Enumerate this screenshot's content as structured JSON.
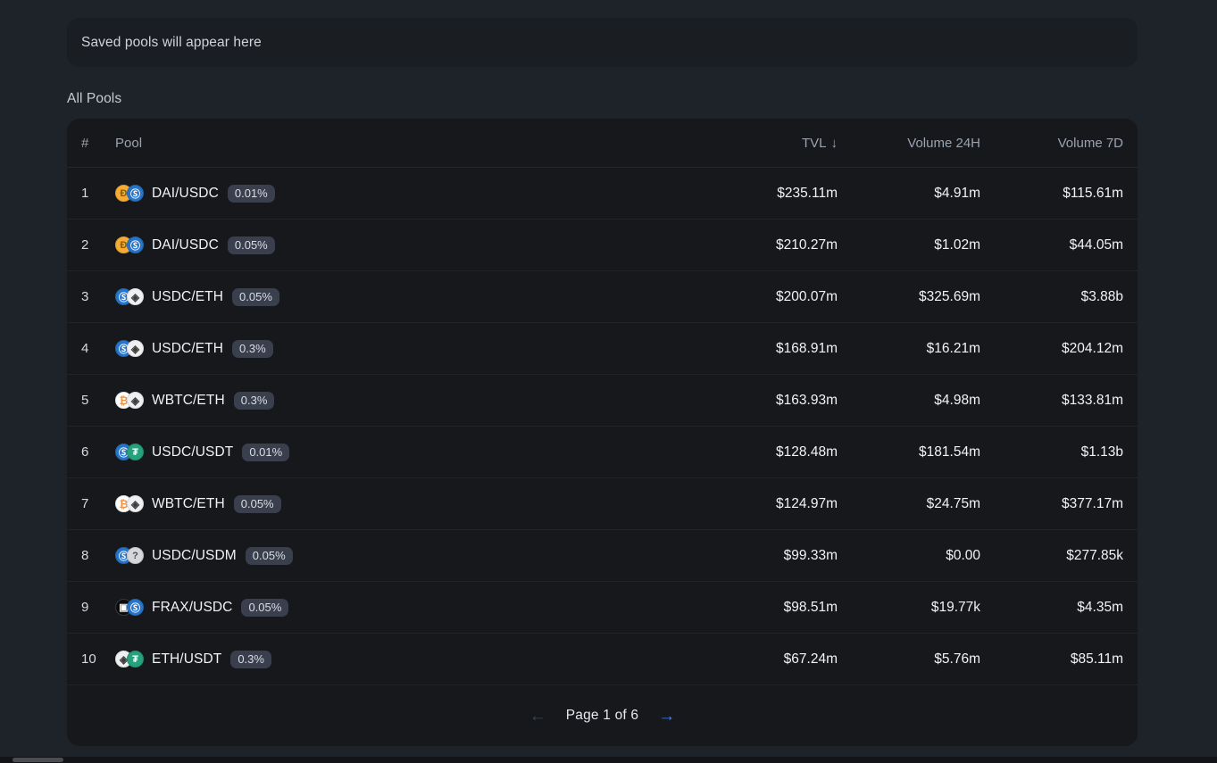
{
  "saved": {
    "empty_text": "Saved pools will appear here"
  },
  "section": {
    "title": "All Pools"
  },
  "table": {
    "headers": {
      "rank": "#",
      "pool": "Pool",
      "tvl": "TVL",
      "tvl_sort_icon": "↓",
      "volume_24h": "Volume 24H",
      "volume_7d": "Volume 7D"
    },
    "rows": [
      {
        "rank": "1",
        "pool": "DAI/USDC",
        "fee": "0.01%",
        "token0": "DAI",
        "token1": "USDC",
        "tvl": "$235.11m",
        "volume_24h": "$4.91m",
        "volume_7d": "$115.61m"
      },
      {
        "rank": "2",
        "pool": "DAI/USDC",
        "fee": "0.05%",
        "token0": "DAI",
        "token1": "USDC",
        "tvl": "$210.27m",
        "volume_24h": "$1.02m",
        "volume_7d": "$44.05m"
      },
      {
        "rank": "3",
        "pool": "USDC/ETH",
        "fee": "0.05%",
        "token0": "USDC",
        "token1": "ETH",
        "tvl": "$200.07m",
        "volume_24h": "$325.69m",
        "volume_7d": "$3.88b"
      },
      {
        "rank": "4",
        "pool": "USDC/ETH",
        "fee": "0.3%",
        "token0": "USDC",
        "token1": "ETH",
        "tvl": "$168.91m",
        "volume_24h": "$16.21m",
        "volume_7d": "$204.12m"
      },
      {
        "rank": "5",
        "pool": "WBTC/ETH",
        "fee": "0.3%",
        "token0": "WBTC",
        "token1": "ETH",
        "tvl": "$163.93m",
        "volume_24h": "$4.98m",
        "volume_7d": "$133.81m"
      },
      {
        "rank": "6",
        "pool": "USDC/USDT",
        "fee": "0.01%",
        "token0": "USDC",
        "token1": "USDT",
        "tvl": "$128.48m",
        "volume_24h": "$181.54m",
        "volume_7d": "$1.13b"
      },
      {
        "rank": "7",
        "pool": "WBTC/ETH",
        "fee": "0.05%",
        "token0": "WBTC",
        "token1": "ETH",
        "tvl": "$124.97m",
        "volume_24h": "$24.75m",
        "volume_7d": "$377.17m"
      },
      {
        "rank": "8",
        "pool": "USDC/USDM",
        "fee": "0.05%",
        "token0": "USDC",
        "token1": "UNKNOWN",
        "tvl": "$99.33m",
        "volume_24h": "$0.00",
        "volume_7d": "$277.85k"
      },
      {
        "rank": "9",
        "pool": "FRAX/USDC",
        "fee": "0.05%",
        "token0": "FRAX",
        "token1": "USDC",
        "tvl": "$98.51m",
        "volume_24h": "$19.77k",
        "volume_7d": "$4.35m"
      },
      {
        "rank": "10",
        "pool": "ETH/USDT",
        "fee": "0.3%",
        "token0": "ETH",
        "token1": "USDT",
        "tvl": "$67.24m",
        "volume_24h": "$5.76m",
        "volume_7d": "$85.11m"
      }
    ]
  },
  "pagination": {
    "prev_icon": "←",
    "next_icon": "→",
    "label": "Page 1 of 6"
  },
  "colors": {
    "page_background": "#1e2229",
    "card_background": "#16181c",
    "banner_background": "#1a1d22",
    "accent_blue": "#3b82f6",
    "muted_text": "#9aa3b0",
    "primary_text": "#f1f3f6",
    "fee_badge_background": "#393f4c"
  }
}
